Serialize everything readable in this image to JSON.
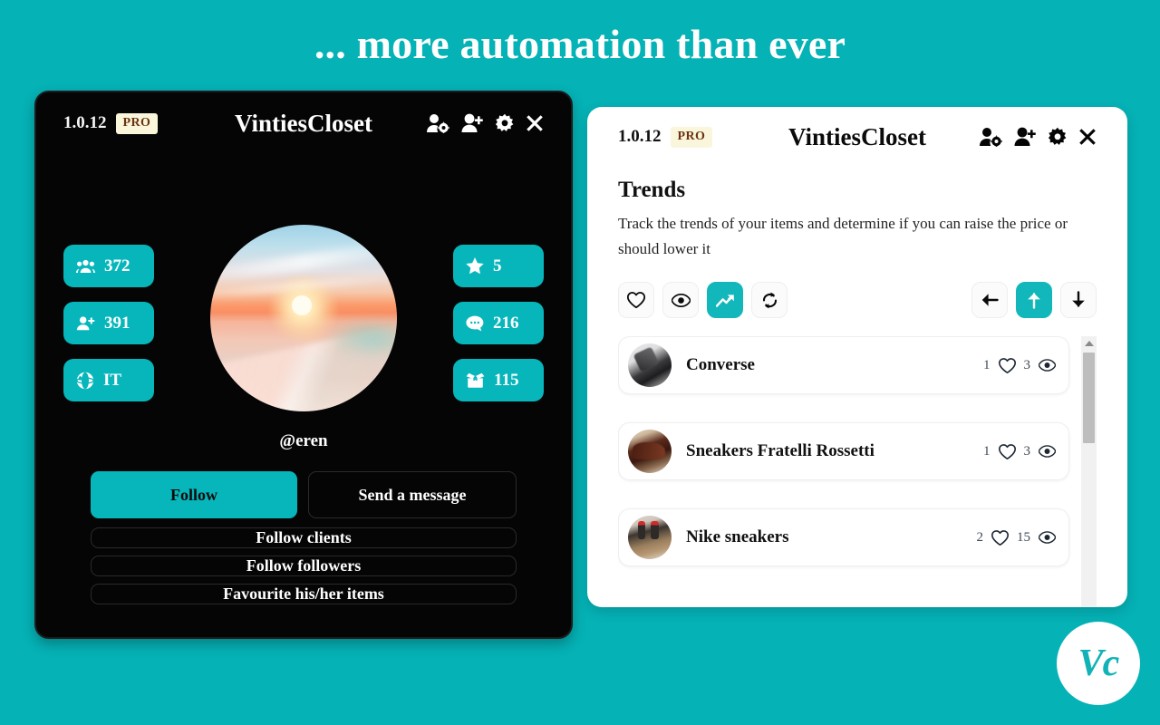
{
  "headline": "... more automation than ever",
  "brand": {
    "accent": "#05b2b6",
    "accent_pill": "#07b6bb",
    "logo_text": "Vc"
  },
  "left_panel": {
    "version": "1.0.12",
    "pro_badge": "PRO",
    "title": "VintiesCloset",
    "header_icons": [
      {
        "name": "user-gear-icon"
      },
      {
        "name": "user-plus-icon"
      },
      {
        "name": "gear-icon"
      },
      {
        "name": "close-icon"
      }
    ],
    "stats_left": [
      {
        "icon": "users-icon",
        "value": "372"
      },
      {
        "icon": "user-plus-icon",
        "value": "391"
      },
      {
        "icon": "globe-icon",
        "value": "IT"
      }
    ],
    "stats_right": [
      {
        "icon": "star-icon",
        "value": "5"
      },
      {
        "icon": "comment-icon",
        "value": "216"
      },
      {
        "icon": "box-open-icon",
        "value": "115"
      }
    ],
    "handle": "@eren",
    "avatar_alt": "sunset-beach-photo",
    "actions_row": [
      {
        "label": "Follow",
        "style": "primary"
      },
      {
        "label": "Send a message",
        "style": "ghost"
      }
    ],
    "actions_stack": [
      {
        "label": "Follow clients"
      },
      {
        "label": "Follow followers"
      },
      {
        "label": "Favourite his/her items"
      }
    ]
  },
  "right_panel": {
    "version": "1.0.12",
    "pro_badge": "PRO",
    "title": "VintiesCloset",
    "header_icons": [
      {
        "name": "user-gear-icon"
      },
      {
        "name": "user-plus-icon"
      },
      {
        "name": "gear-icon"
      },
      {
        "name": "close-icon"
      }
    ],
    "section_title": "Trends",
    "section_desc": "Track the trends of your items and determine if you can raise the price or should lower it",
    "toolbar_left": [
      {
        "name": "heart-icon",
        "active": false
      },
      {
        "name": "eye-icon",
        "active": false
      },
      {
        "name": "trend-up-icon",
        "active": true
      },
      {
        "name": "refresh-icon",
        "active": false
      }
    ],
    "toolbar_right": [
      {
        "name": "arrow-left-icon",
        "active": false
      },
      {
        "name": "arrow-up-icon",
        "active": true
      },
      {
        "name": "arrow-down-icon",
        "active": false
      }
    ],
    "items": [
      {
        "name": "Converse",
        "likes": "1",
        "views": "3",
        "thumb": "converse-sneaker-photo"
      },
      {
        "name": "Sneakers Fratelli Rossetti",
        "likes": "1",
        "views": "3",
        "thumb": "brown-leather-shoes-photo"
      },
      {
        "name": "Nike sneakers",
        "likes": "2",
        "views": "15",
        "thumb": "nike-sneakers-photo"
      }
    ]
  }
}
